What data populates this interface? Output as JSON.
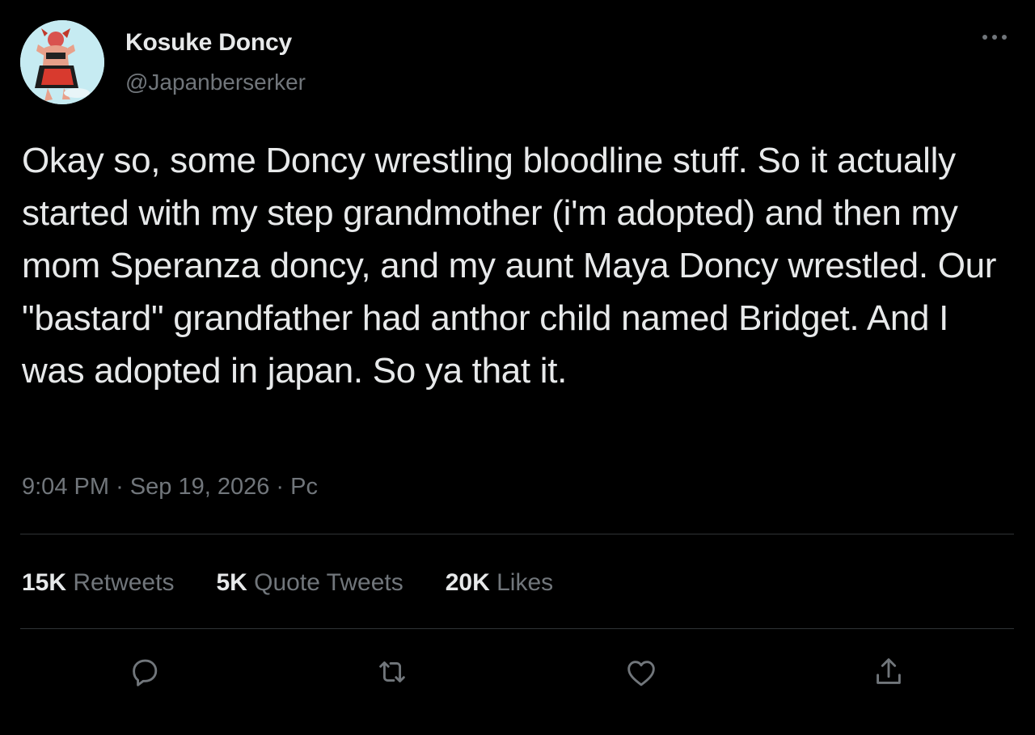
{
  "author": {
    "display_name": "Kosuke Doncy",
    "handle": "@Japanberserker",
    "avatar_icon": "avatar-image"
  },
  "tweet": {
    "text": "Okay so, some Doncy wrestling bloodline stuff. So it actually started with my step grandmother (i'm adopted) and then my mom Speranza doncy, and my aunt Maya Doncy wrestled. Our \"bastard\" grandfather had anthor child named Bridget. And I was adopted in japan. So ya that it.",
    "time": "9:04 PM",
    "separator": "·",
    "date": "Sep 19, 2026",
    "source": "Pc"
  },
  "stats": {
    "retweets": {
      "count": "15K",
      "label": "Retweets"
    },
    "quotes": {
      "count": "5K",
      "label": "Quote Tweets"
    },
    "likes": {
      "count": "20K",
      "label": "Likes"
    }
  },
  "actions": [
    {
      "name": "reply",
      "icon": "reply-icon"
    },
    {
      "name": "retweet",
      "icon": "retweet-icon"
    },
    {
      "name": "like",
      "icon": "heart-icon"
    },
    {
      "name": "share",
      "icon": "share-icon"
    }
  ],
  "colors": {
    "background": "#000000",
    "primary_text": "#e7e9ea",
    "secondary_text": "#71767b",
    "divider": "#2f3336"
  }
}
